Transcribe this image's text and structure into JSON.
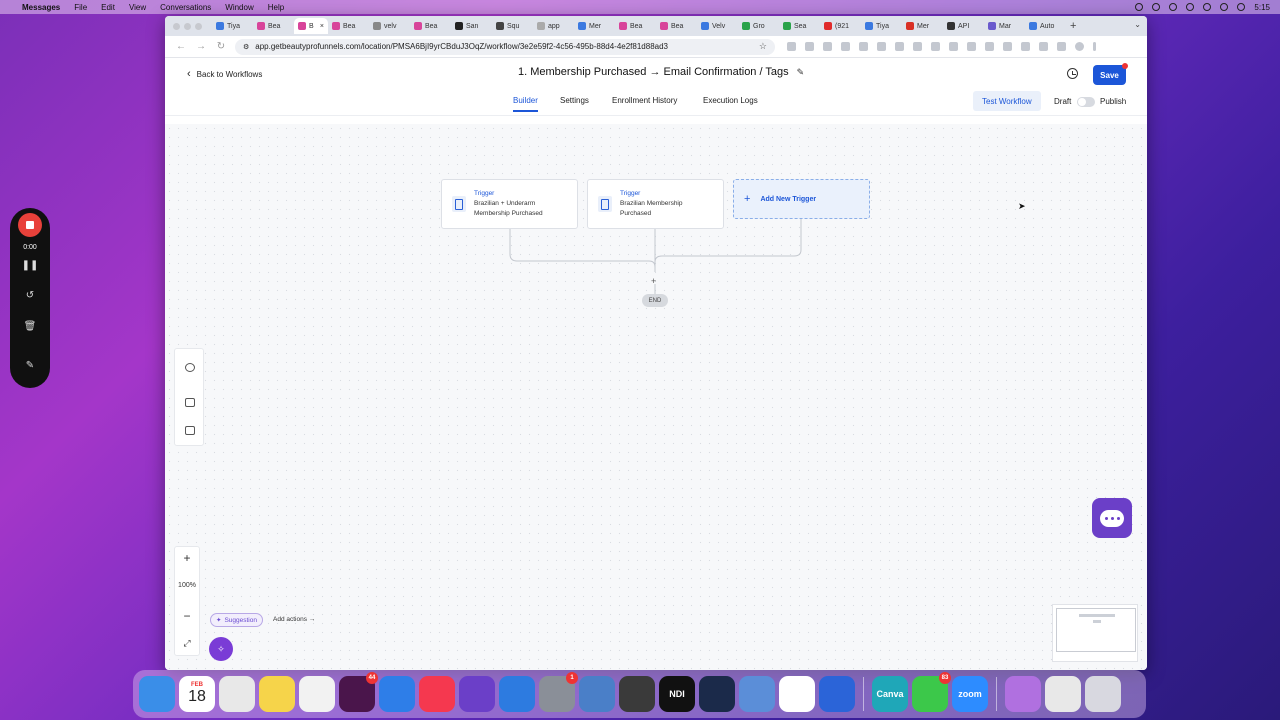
{
  "menubar": {
    "app_name": "Messages",
    "items": [
      "File",
      "Edit",
      "View",
      "Conversations",
      "Window",
      "Help"
    ],
    "clock": "5:15"
  },
  "browser": {
    "tabs": [
      {
        "label": "Tiya",
        "color": "#3b79e0"
      },
      {
        "label": "Bea",
        "color": "#d8449a"
      },
      {
        "label": "B",
        "color": "#d8449a",
        "active": true
      },
      {
        "label": "Bea",
        "color": "#d8449a"
      },
      {
        "label": "velv",
        "color": "#888888"
      },
      {
        "label": "Bea",
        "color": "#d8449a"
      },
      {
        "label": "San",
        "color": "#222222"
      },
      {
        "label": "Squ",
        "color": "#444444"
      },
      {
        "label": "app",
        "color": "#aaaaaa"
      },
      {
        "label": "Mer",
        "color": "#3b79e0"
      },
      {
        "label": "Bea",
        "color": "#d8449a"
      },
      {
        "label": "Bea",
        "color": "#d8449a"
      },
      {
        "label": "Velv",
        "color": "#3b79e0"
      },
      {
        "label": "Gro",
        "color": "#2aa34a"
      },
      {
        "label": "Sea",
        "color": "#2aa34a"
      },
      {
        "label": "(921",
        "color": "#e02b2b"
      },
      {
        "label": "Tiya",
        "color": "#3b79e0"
      },
      {
        "label": "Mer",
        "color": "#d93025"
      },
      {
        "label": "API",
        "color": "#333333"
      },
      {
        "label": "Mar",
        "color": "#6a5acd"
      },
      {
        "label": "Auto",
        "color": "#3b79e0"
      }
    ],
    "url": "app.getbeautyprofunnels.com/location/PMSA6BjI9yrCBduJ3OqZ/workflow/3e2e59f2-4c56-495b-88d4-4e2f81d88ad3"
  },
  "header": {
    "back_label": "Back to Workflows",
    "title": "1. Membership Purchased → Email Confirmation / Tags",
    "save_label": "Save"
  },
  "subnav": {
    "tabs": [
      "Builder",
      "Settings",
      "Enrollment History",
      "Execution Logs"
    ],
    "test_label": "Test Workflow",
    "draft_label": "Draft",
    "publish_label": "Publish",
    "published": false
  },
  "canvas": {
    "triggers": [
      {
        "title": "Trigger",
        "line1": "Brazilian + Underarm",
        "line2": "Membership Purchased"
      },
      {
        "title": "Trigger",
        "line1": "Brazilian Membership",
        "line2": "Purchased"
      }
    ],
    "add_trigger_label": "Add New Trigger",
    "end_label": "END",
    "zoom_level": "100%",
    "suggestion_label": "Suggestion",
    "add_actions_label": "Add actions"
  },
  "recorder": {
    "time": "0:00"
  },
  "dock": {
    "calendar_month": "FEB",
    "calendar_day": "18",
    "apps": [
      {
        "name": "finder",
        "color": "#3a8ee8"
      },
      {
        "name": "calendar",
        "color": "#ffffff"
      },
      {
        "name": "chrome",
        "color": "#e8e8e8"
      },
      {
        "name": "notes",
        "color": "#f6d44a"
      },
      {
        "name": "reminders",
        "color": "#f2f2f2"
      },
      {
        "name": "slack",
        "color": "#4a154b",
        "badge": "44"
      },
      {
        "name": "keynote",
        "color": "#2e7ee8"
      },
      {
        "name": "music",
        "color": "#f5384f"
      },
      {
        "name": "imovie",
        "color": "#6b3fc8"
      },
      {
        "name": "settings-wheel",
        "color": "#2d7be0"
      },
      {
        "name": "system-preferences",
        "color": "#8a8f98",
        "badge": "1"
      },
      {
        "name": "preview",
        "color": "#4a7fc8"
      },
      {
        "name": "calculator",
        "color": "#3a3a3a"
      },
      {
        "name": "ndi",
        "color": "#111111"
      },
      {
        "name": "quicktime",
        "color": "#1b2a4a"
      },
      {
        "name": "print-center",
        "color": "#5b8ed8"
      },
      {
        "name": "clickup",
        "color": "#ffffff"
      },
      {
        "name": "support",
        "color": "#2b64d8"
      },
      {
        "name": "canva",
        "color": "#1fa7b8"
      },
      {
        "name": "messages",
        "color": "#3cc84a",
        "badge": "83"
      },
      {
        "name": "zoom",
        "color": "#2d8cff"
      },
      {
        "name": "help",
        "color": "#b070e0"
      },
      {
        "name": "window-manager",
        "color": "#e8e8e8"
      },
      {
        "name": "trash",
        "color": "#d8d8e0"
      }
    ],
    "labels": {
      "canva": "Canva",
      "zoom": "zoom",
      "ndi": "NDI"
    }
  }
}
